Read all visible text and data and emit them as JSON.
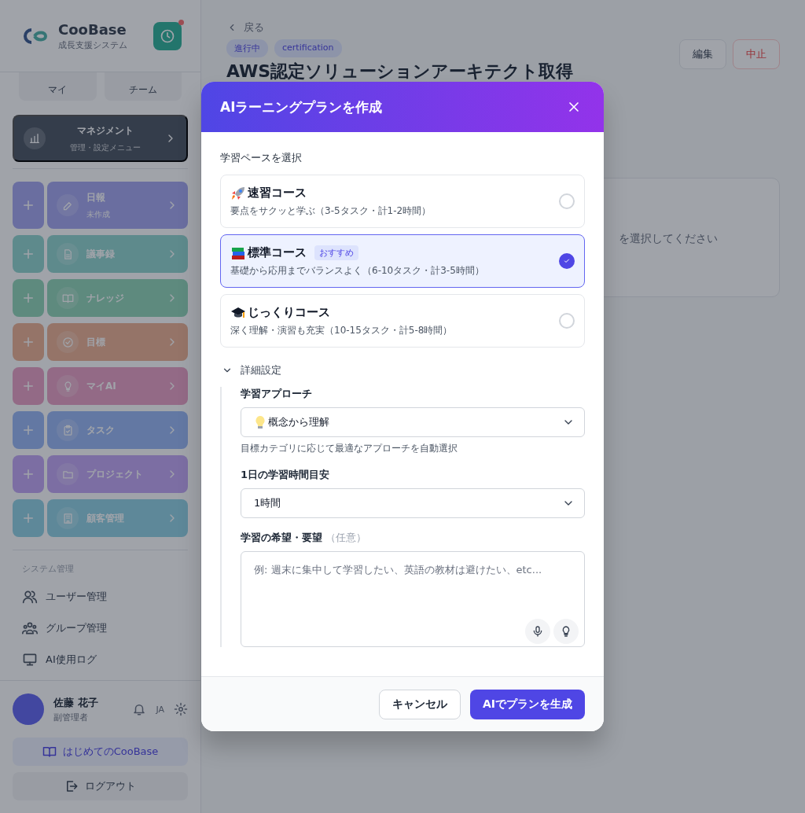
{
  "sidebar": {
    "brand": {
      "name": "CooBase",
      "subtitle": "成長支援システム"
    },
    "quick_tabs": [
      {
        "label": "マイ"
      },
      {
        "label": "チーム"
      }
    ],
    "management": {
      "title": "マネジメント",
      "subtitle": "管理・設定メニュー"
    },
    "nav_items": [
      {
        "label": "日報",
        "sub": "未作成",
        "color": "#6a6ea0"
      },
      {
        "label": "議事録",
        "color": "#5e8a8c"
      },
      {
        "label": "ナレッジ",
        "color": "#5e8a7e"
      },
      {
        "label": "目標",
        "color": "#957468"
      },
      {
        "label": "マイAI",
        "color": "#936a86"
      },
      {
        "label": "タスク",
        "color": "#6378a3"
      },
      {
        "label": "プロジェクト",
        "color": "#7c6ea3"
      },
      {
        "label": "顧客管理",
        "color": "#5e8899"
      }
    ],
    "system": {
      "heading": "システム管理",
      "items": [
        {
          "label": "ユーザー管理"
        },
        {
          "label": "グループ管理"
        },
        {
          "label": "AI使用ログ"
        }
      ]
    },
    "user": {
      "name": "佐藤 花子",
      "role": "副管理者",
      "language": "JA"
    },
    "guide_button": "はじめてのCooBase",
    "logout_button": "ログアウト"
  },
  "main": {
    "back": "戻る",
    "tags": [
      "進行中",
      "certification"
    ],
    "title": "AWS認定ソリューションアーキテクト取得",
    "actions": [
      {
        "label": "編集",
        "kind": "neutral"
      },
      {
        "label": "中止",
        "kind": "danger"
      }
    ],
    "card_hint": "を選択してください"
  },
  "modal": {
    "title": "AIラーニングプランを作成",
    "pace_label": "学習ペースを選択",
    "courses": [
      {
        "title": "速習コース",
        "description": "要点をサクッと学ぶ（3-5タスク・計1-2時間）",
        "selected": false
      },
      {
        "title": "標準コース",
        "badge": "おすすめ",
        "description": "基礎から応用までバランスよく（6-10タスク・計3-5時間）",
        "selected": true
      },
      {
        "title": "じっくりコース",
        "description": "深く理解・演習も充実（10-15タスク・計5-8時間）",
        "selected": false
      }
    ],
    "advanced": {
      "label": "詳細設定",
      "expanded": true,
      "approach": {
        "label": "学習アプローチ",
        "value": "概念から理解",
        "help": "目標カテゴリに応じて最適なアプローチを自動選択"
      },
      "daily_time": {
        "label": "1日の学習時間目安",
        "value": "1時間"
      },
      "wishes": {
        "label": "学習の希望・要望",
        "optional": "（任意）",
        "placeholder": "例: 週末に集中して学習したい、英語の教材は避けたい、etc..."
      }
    },
    "buttons": [
      {
        "label": "キャンセル",
        "kind": "secondary"
      },
      {
        "label": "AIでプランを生成",
        "kind": "primary"
      }
    ]
  }
}
